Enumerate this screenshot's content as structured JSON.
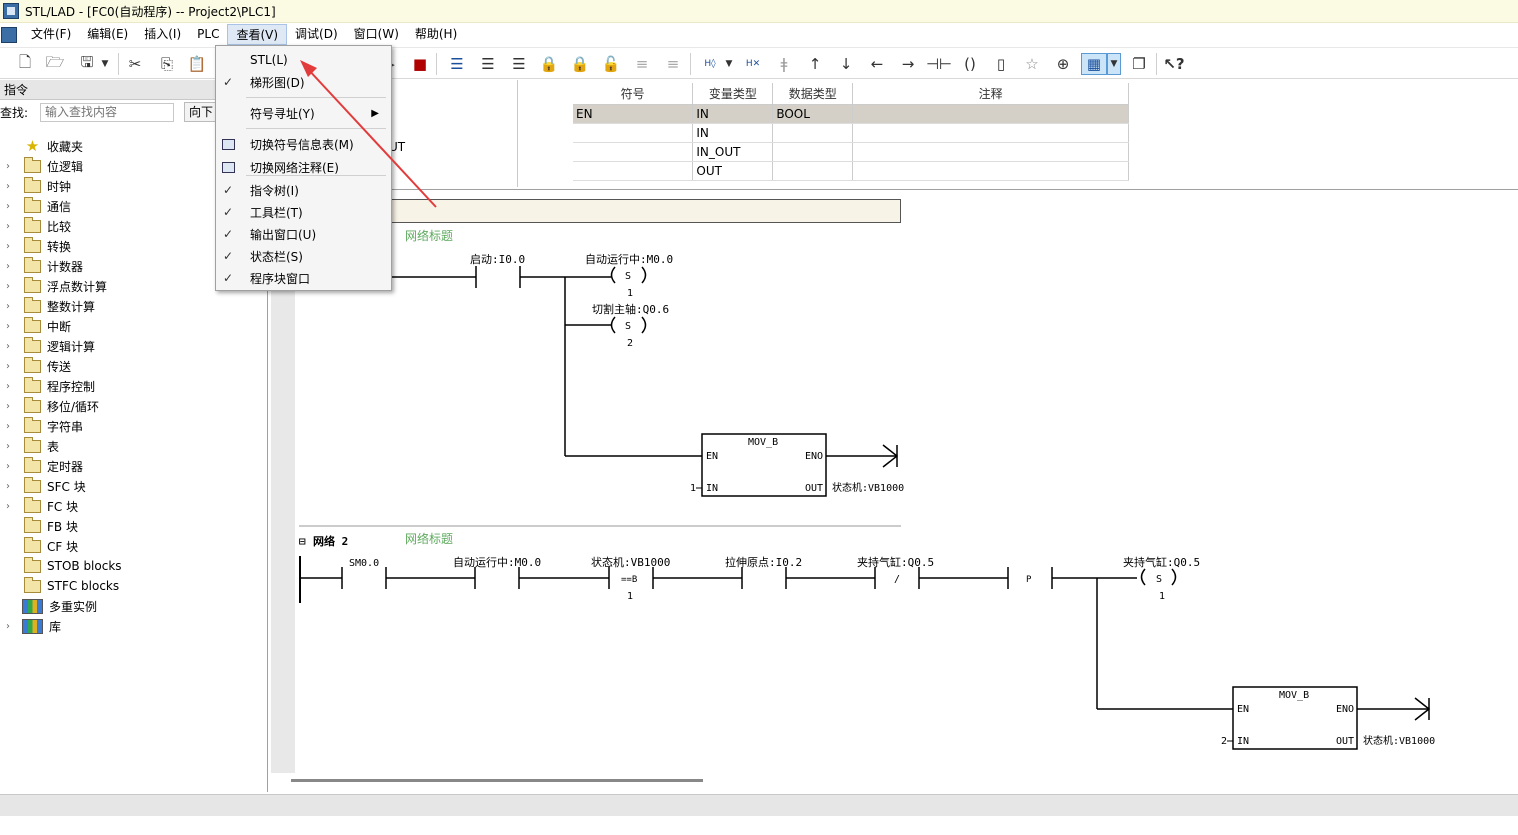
{
  "window": {
    "title": "STL/LAD - [FC0(自动程序) -- Project2\\PLC1]"
  },
  "menubar": {
    "items": [
      "文件(F)",
      "编辑(E)",
      "插入(I)",
      "PLC",
      "查看(V)",
      "调试(D)",
      "窗口(W)",
      "帮助(H)"
    ]
  },
  "view_menu": {
    "items": [
      {
        "label": "STL(L)",
        "checked": false
      },
      {
        "label": "梯形图(D)",
        "checked": true
      },
      {
        "label": "符号寻址(Y)",
        "checked": false,
        "submenu": true
      },
      {
        "label": "切换符号信息表(M)",
        "checked": false,
        "icon": "symbol-table-icon"
      },
      {
        "label": "切换网络注释(E)",
        "checked": false,
        "icon": "network-comment-icon"
      },
      {
        "label": "指令树(I)",
        "checked": true
      },
      {
        "label": "工具栏(T)",
        "checked": true
      },
      {
        "label": "输出窗口(U)",
        "checked": true
      },
      {
        "label": "状态栏(S)",
        "checked": true
      },
      {
        "label": "程序块窗口",
        "checked": true
      }
    ]
  },
  "instructions_panel": {
    "header": "指令",
    "search_label": "查找:",
    "search_placeholder": "输入查找内容",
    "direction": "向下",
    "tree": [
      {
        "label": "收藏夹",
        "icon": "star-icon",
        "expandable": false
      },
      {
        "label": "位逻辑",
        "icon": "folder-icon",
        "expandable": true
      },
      {
        "label": "时钟",
        "icon": "folder-icon",
        "expandable": true
      },
      {
        "label": "通信",
        "icon": "folder-icon",
        "expandable": true
      },
      {
        "label": "比较",
        "icon": "folder-icon",
        "expandable": true
      },
      {
        "label": "转换",
        "icon": "folder-icon",
        "expandable": true
      },
      {
        "label": "计数器",
        "icon": "folder-icon",
        "expandable": true
      },
      {
        "label": "浮点数计算",
        "icon": "folder-icon",
        "expandable": true
      },
      {
        "label": "整数计算",
        "icon": "folder-icon",
        "expandable": true
      },
      {
        "label": "中断",
        "icon": "folder-icon",
        "expandable": true
      },
      {
        "label": "逻辑计算",
        "icon": "folder-icon",
        "expandable": true
      },
      {
        "label": "传送",
        "icon": "folder-icon",
        "expandable": true
      },
      {
        "label": "程序控制",
        "icon": "folder-icon",
        "expandable": true
      },
      {
        "label": "移位/循环",
        "icon": "folder-icon",
        "expandable": true
      },
      {
        "label": "字符串",
        "icon": "folder-icon",
        "expandable": true
      },
      {
        "label": "表",
        "icon": "folder-icon",
        "expandable": true
      },
      {
        "label": "定时器",
        "icon": "folder-icon",
        "expandable": true
      },
      {
        "label": "SFC 块",
        "icon": "folder-icon",
        "expandable": true
      },
      {
        "label": "FC 块",
        "icon": "folder-icon",
        "expandable": true
      },
      {
        "label": "FB 块",
        "icon": "folder-icon",
        "expandable": false
      },
      {
        "label": "CF 块",
        "icon": "folder-icon",
        "expandable": false
      },
      {
        "label": "STOB blocks",
        "icon": "folder-icon",
        "expandable": false
      },
      {
        "label": "STFC blocks",
        "icon": "folder-icon",
        "expandable": false
      },
      {
        "label": "多重实例",
        "icon": "books-icon",
        "expandable": false
      },
      {
        "label": "库",
        "icon": "books-icon",
        "expandable": true
      }
    ]
  },
  "var_table": {
    "side_label": "UT",
    "headers": [
      "符号",
      "变量类型",
      "数据类型",
      "注释"
    ],
    "rows": [
      [
        "EN",
        "IN",
        "BOOL",
        ""
      ],
      [
        "",
        "IN",
        "",
        ""
      ],
      [
        "",
        "IN_OUT",
        "",
        ""
      ],
      [
        "",
        "OUT",
        "",
        ""
      ]
    ]
  },
  "network1": {
    "title": "网络标题",
    "contact1": "启动:I0.0",
    "coil1": "自动运行中:M0.0",
    "coil1_type": "S",
    "coil1_n": "1",
    "coil2": "切割主轴:Q0.6",
    "coil2_type": "S",
    "coil2_n": "2",
    "box_name": "MOV_B",
    "box_en": "EN",
    "box_eno": "ENO",
    "box_in": "IN",
    "box_out": "OUT",
    "in_val": "1",
    "out_var": "状态机:VB1000"
  },
  "network2": {
    "label": "网络 2",
    "title": "网络标题",
    "c1": "SM0.0",
    "c2": "自动运行中:M0.0",
    "c3": "状态机:VB1000",
    "c3_op": "==B",
    "c3_val": "1",
    "c4": "拉伸原点:I0.2",
    "c5": "夹持气缸:Q0.5",
    "c5_neg": "/",
    "c6_edge": "P",
    "coil": "夹持气缸:Q0.5",
    "coil_type": "S",
    "coil_n": "1",
    "box_name": "MOV_B",
    "box_en": "EN",
    "box_eno": "ENO",
    "box_in": "IN",
    "box_out": "OUT",
    "in_val": "2",
    "out_var": "状态机:VB1000"
  }
}
